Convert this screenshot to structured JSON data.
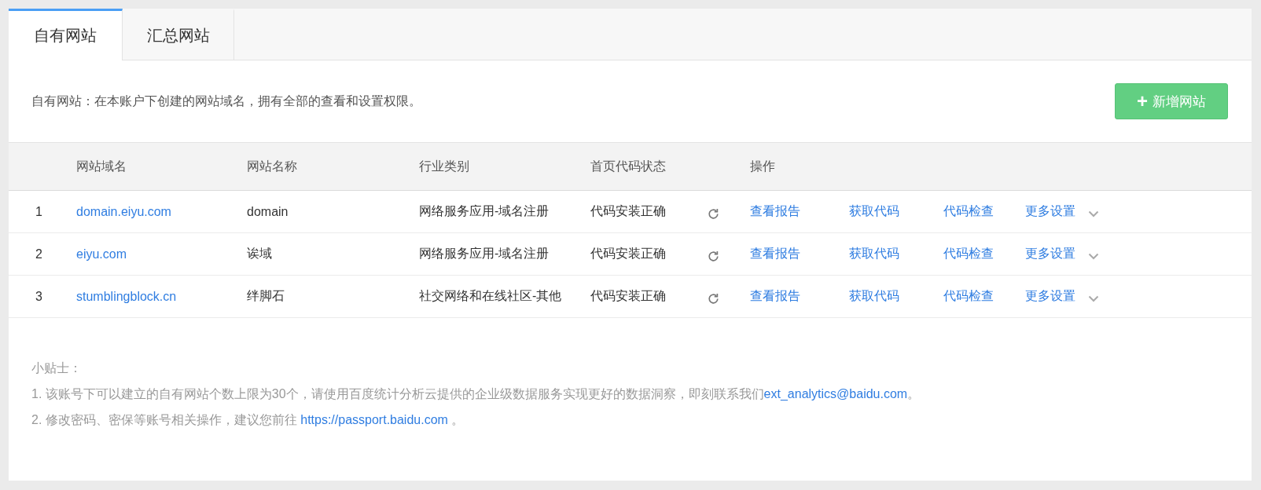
{
  "tabs": [
    {
      "label": "自有网站",
      "selected": true
    },
    {
      "label": "汇总网站",
      "selected": false
    }
  ],
  "description": "自有网站：在本账户下创建的网站域名，拥有全部的查看和设置权限。",
  "add_button": {
    "icon": "+",
    "label": "新增网站"
  },
  "table": {
    "columns": [
      "网站域名",
      "网站名称",
      "行业类别",
      "首页代码状态",
      "操作"
    ],
    "rows": [
      {
        "index": "1",
        "domain": "domain.eiyu.com",
        "name": "domain",
        "industry": "网络服务应用-域名注册",
        "status": "代码安装正确",
        "actions": [
          {
            "kind": "link",
            "label": "查看报告"
          },
          {
            "kind": "link",
            "label": "获取代码"
          },
          {
            "kind": "link",
            "label": "代码检查"
          },
          {
            "kind": "dropdown",
            "label": "更多设置"
          }
        ]
      },
      {
        "index": "2",
        "domain": "eiyu.com",
        "name": "诶域",
        "industry": "网络服务应用-域名注册",
        "status": "代码安装正确",
        "actions": [
          {
            "kind": "link",
            "label": "查看报告"
          },
          {
            "kind": "link",
            "label": "获取代码"
          },
          {
            "kind": "link",
            "label": "代码检查"
          },
          {
            "kind": "dropdown",
            "label": "更多设置"
          }
        ]
      },
      {
        "index": "3",
        "domain": "stumblingblock.cn",
        "name": "绊脚石",
        "industry": "社交网络和在线社区-其他",
        "status": "代码安装正确",
        "actions": [
          {
            "kind": "link",
            "label": "查看报告"
          },
          {
            "kind": "link",
            "label": "获取代码"
          },
          {
            "kind": "link",
            "label": "代码检查"
          },
          {
            "kind": "dropdown",
            "label": "更多设置"
          }
        ]
      }
    ]
  },
  "tips": {
    "title": "小贴士：",
    "items": [
      {
        "text": "1. 该账号下可以建立的自有网站个数上限为30个，请使用百度统计分析云提供的企业级数据服务实现更好的数据洞察，即刻联系我们",
        "link": "ext_analytics@baidu.com",
        "suffix": "。"
      },
      {
        "text": "2. 修改密码、密保等账号相关操作，建议您前往 ",
        "link": "https://passport.baidu.com",
        "suffix": " 。"
      }
    ]
  }
}
